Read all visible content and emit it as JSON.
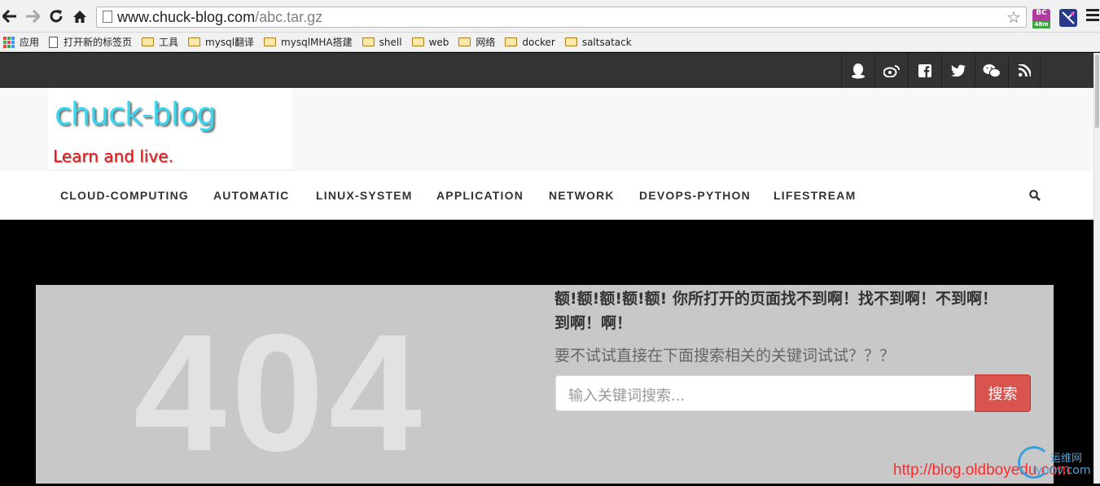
{
  "browser": {
    "url_host": "www.chuck-blog.com",
    "url_path": "/abc.tar.gz",
    "ext1_label": "BC",
    "ext1_badge": "48m",
    "icons": [
      "back-arrow-icon",
      "forward-arrow-icon",
      "reload-icon",
      "home-icon",
      "page-icon",
      "star-icon",
      "menu-icon"
    ]
  },
  "bookmarks": [
    {
      "label": "应用",
      "icon": "apps-icon"
    },
    {
      "label": "打开新的标签页",
      "icon": "page-icon"
    },
    {
      "label": "工具",
      "icon": "folder-icon"
    },
    {
      "label": "mysql翻译",
      "icon": "folder-icon"
    },
    {
      "label": "mysqlMHA搭建",
      "icon": "folder-icon"
    },
    {
      "label": "shell",
      "icon": "folder-icon"
    },
    {
      "label": "web",
      "icon": "folder-icon"
    },
    {
      "label": "网络",
      "icon": "folder-icon"
    },
    {
      "label": "docker",
      "icon": "folder-icon"
    },
    {
      "label": "saltsatack",
      "icon": "folder-icon"
    }
  ],
  "social": [
    "qq-icon",
    "weibo-icon",
    "facebook-icon",
    "twitter-icon",
    "wechat-icon",
    "rss-icon"
  ],
  "site": {
    "title": "chuck-blog",
    "tagline": "Learn and live."
  },
  "nav": [
    "CLOUD-COMPUTING",
    "AUTOMATIC",
    "LINUX-SYSTEM",
    "APPLICATION",
    "NETWORK",
    "DEVOPS-PYTHON",
    "LIFESTREAM"
  ],
  "error": {
    "code": "404",
    "title": "额!额!额!额!额! 你所打开的页面找不到啊！找不到啊！不到啊！到啊！啊！",
    "subtitle": "要不试试直接在下面搜索相关的关键词试试？？？",
    "search_placeholder": "输入关键词搜索...",
    "search_button": "搜索"
  },
  "watermark": {
    "url": "http://blog.oldboyedu.com",
    "brand_cn": "运维网",
    "brand_domain": "iyunv.com"
  },
  "colors": {
    "accent": "#d9534f",
    "logo": "#3ad5ee",
    "tagline": "#e41b1b"
  }
}
